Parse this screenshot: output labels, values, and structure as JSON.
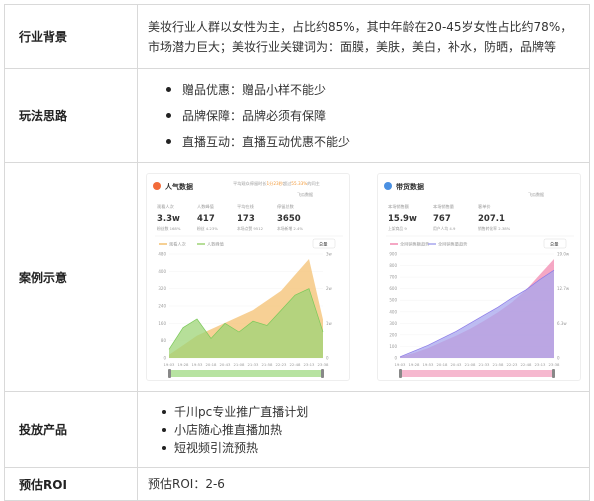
{
  "rows": [
    {
      "label": "行业背景",
      "text_lines": [
        "美妆行业人群以女性为主，占比约85%，其中年龄在20-45岁女性占比约78%，",
        "市场潜力巨大；美妆行业关键词为：面膜，美肤，美白，补水，防晒，品牌等"
      ]
    },
    {
      "label": "玩法思路",
      "bullets": [
        "赠品优惠：赠品小样不能少",
        "品牌保障：品牌必须有保障",
        "直播互动：直播互动优惠不能少"
      ]
    },
    {
      "label": "案例示意"
    },
    {
      "label": "投放产品",
      "bullets": [
        "千川pc专业推广直播计划",
        "小店随心推直播加热",
        "短视频引流预热"
      ]
    },
    {
      "label": "预估ROI",
      "text": "预估ROI：2-6"
    }
  ],
  "left_panel": {
    "title": "人气数据",
    "header_note_a": "平均观众停留时长",
    "header_note_hl": "1分23秒",
    "header_note_b": "超过",
    "header_note_hl2": "55.33%",
    "header_note_c": "的同主",
    "badge": "飞瓜数据",
    "stats": [
      {
        "label": "观看人次",
        "value": "3.3w",
        "sub": "粉丝数 168%"
      },
      {
        "label": "人数峰值",
        "value": "417",
        "sub": "粉丝 4.23%"
      },
      {
        "label": "平均在线",
        "value": "173",
        "sub": "本场点赞 9512"
      },
      {
        "label": "停留总数",
        "value": "3650",
        "sub": "本场新增 2.4%"
      }
    ],
    "legend": [
      "观看人次",
      "人数峰值"
    ],
    "toggle": "总量",
    "colors": {
      "area1": "#f4c071",
      "area2": "#9dd477",
      "line": "#7bc95a"
    }
  },
  "right_panel": {
    "title": "带货数据",
    "badge": "飞瓜数据",
    "stats": [
      {
        "label": "本场销售额",
        "value": "15.9w",
        "sub": "上架商品 9"
      },
      {
        "label": "本场销售量",
        "value": "767",
        "sub": "用户人均 4.9"
      },
      {
        "label": "客单价",
        "value": "207.1",
        "sub": "销售转化率 2.38%"
      }
    ],
    "legend": [
      "全网销售额趋势",
      "全网销售量趋势"
    ],
    "toggle": "总量",
    "colors": {
      "area1": "#f28ab0",
      "area2": "#a7a6ee"
    }
  },
  "chart_data": [
    {
      "type": "area",
      "title": "人气数据",
      "x": [
        "19:03",
        "19:28",
        "19:53",
        "20:18",
        "20:43",
        "21:08",
        "21:33",
        "21:58",
        "22:23",
        "22:48",
        "23:13",
        "23:38"
      ],
      "series": [
        {
          "name": "观看人次",
          "values": [
            0.1,
            0.4,
            0.7,
            0.9,
            1.1,
            1.3,
            1.5,
            1.8,
            2.1,
            2.6,
            3.1,
            1.2
          ]
        },
        {
          "name": "人数峰值",
          "values": [
            40,
            140,
            180,
            90,
            160,
            120,
            170,
            150,
            220,
            290,
            320,
            120
          ]
        }
      ],
      "y_left_ticks": [
        0,
        80,
        160,
        240,
        320,
        400,
        480
      ],
      "y_right_ticks": [
        "0",
        "1w",
        "2w",
        "3w"
      ],
      "ylim": [
        0,
        480
      ]
    },
    {
      "type": "area",
      "title": "带货数据",
      "x": [
        "19:03",
        "19:28",
        "19:53",
        "20:18",
        "20:43",
        "21:08",
        "21:33",
        "21:58",
        "22:23",
        "22:48",
        "23:13",
        "23:38"
      ],
      "series": [
        {
          "name": "全网销售额趋势",
          "values": [
            0.2,
            0.8,
            1.6,
            2.6,
            3.6,
            4.7,
            6.0,
            7.4,
            9.0,
            11.0,
            13.5,
            16.0
          ]
        },
        {
          "name": "全网销售量趋势",
          "values": [
            10,
            60,
            110,
            170,
            230,
            300,
            370,
            440,
            520,
            590,
            680,
            760
          ]
        }
      ],
      "y_left_ticks": [
        0,
        100,
        200,
        300,
        400,
        500,
        600,
        700,
        800,
        900
      ],
      "y_right_ticks": [
        "0",
        "6.3w",
        "12.7w",
        "19.0w"
      ],
      "ylim": [
        0,
        900
      ]
    }
  ]
}
